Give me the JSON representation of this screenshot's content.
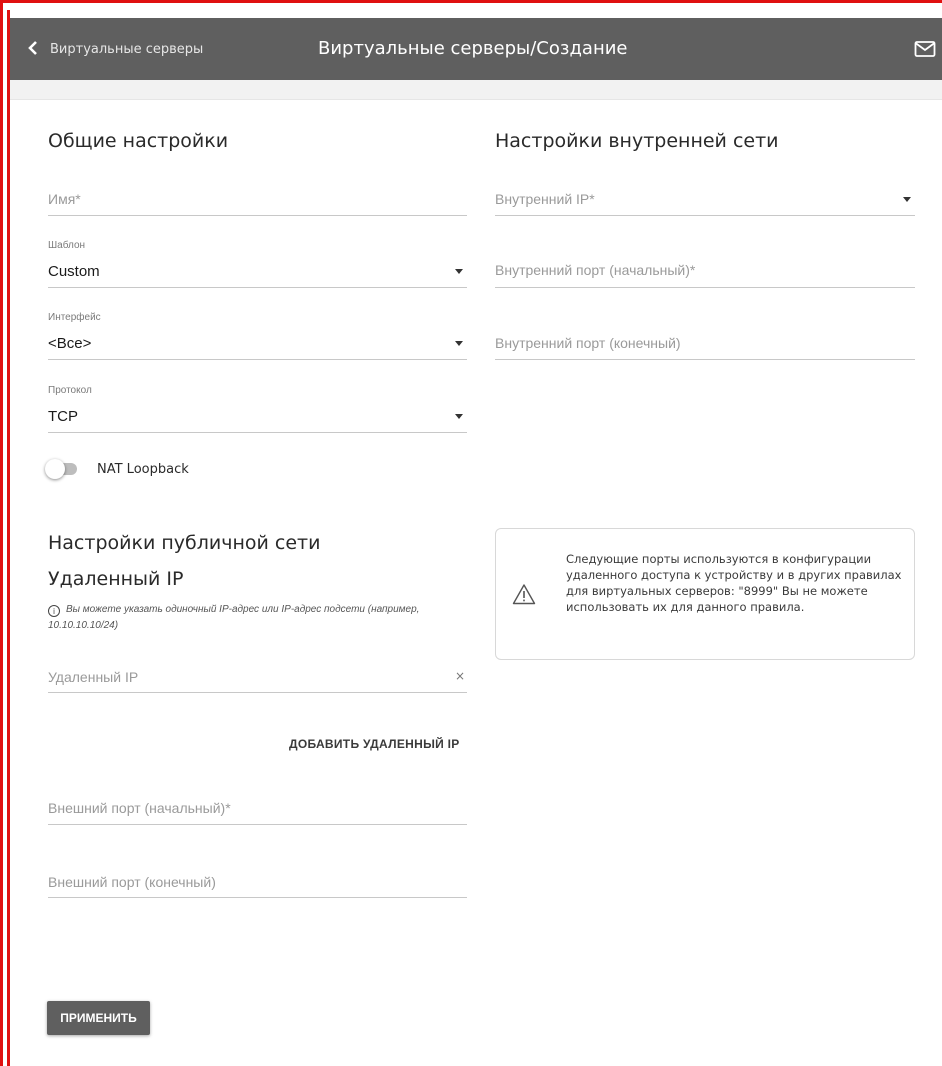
{
  "header": {
    "back_label": "Виртуальные серверы",
    "title": "Виртуальные серверы/Создание"
  },
  "general": {
    "heading": "Общие настройки",
    "name": {
      "placeholder": "Имя*"
    },
    "template": {
      "label": "Шаблон",
      "value": "Custom"
    },
    "interface": {
      "label": "Интерфейс",
      "value": "<Все>"
    },
    "protocol": {
      "label": "Протокол",
      "value": "TCP"
    },
    "nat_loopback": {
      "label": "NAT Loopback",
      "enabled": false
    }
  },
  "internal": {
    "heading": "Настройки внутренней сети",
    "ip": {
      "placeholder": "Внутренний IP*"
    },
    "port_start": {
      "placeholder": "Внутренний порт (начальный)*"
    },
    "port_end": {
      "placeholder": "Внутренний порт (конечный)"
    }
  },
  "public": {
    "heading": "Настройки публичной сети",
    "remote_ip_heading": "Удаленный IP",
    "hint": "Вы можете указать одиночный IP-адрес или IP-адрес подсети (например, 10.10.10.10/24)",
    "remote_ip": {
      "placeholder": "Удаленный IP",
      "clear": "×"
    },
    "add_remote_ip": "ДОБАВИТЬ УДАЛЕННЫЙ IP",
    "ext_port_start": {
      "placeholder": "Внешний порт (начальный)*"
    },
    "ext_port_end": {
      "placeholder": "Внешний порт (конечный)"
    }
  },
  "warning": {
    "text": "Следующие порты используются в конфигурации удаленного доступа к устройству и в других правилах для виртуальных серверов: \"8999\" Вы не можете использовать их для данного правила."
  },
  "apply_label": "ПРИМЕНИТЬ",
  "icons": {
    "back": "chevron-left-icon",
    "mail": "envelope-icon",
    "info": "info-circle-icon",
    "warning": "warning-triangle-icon"
  }
}
